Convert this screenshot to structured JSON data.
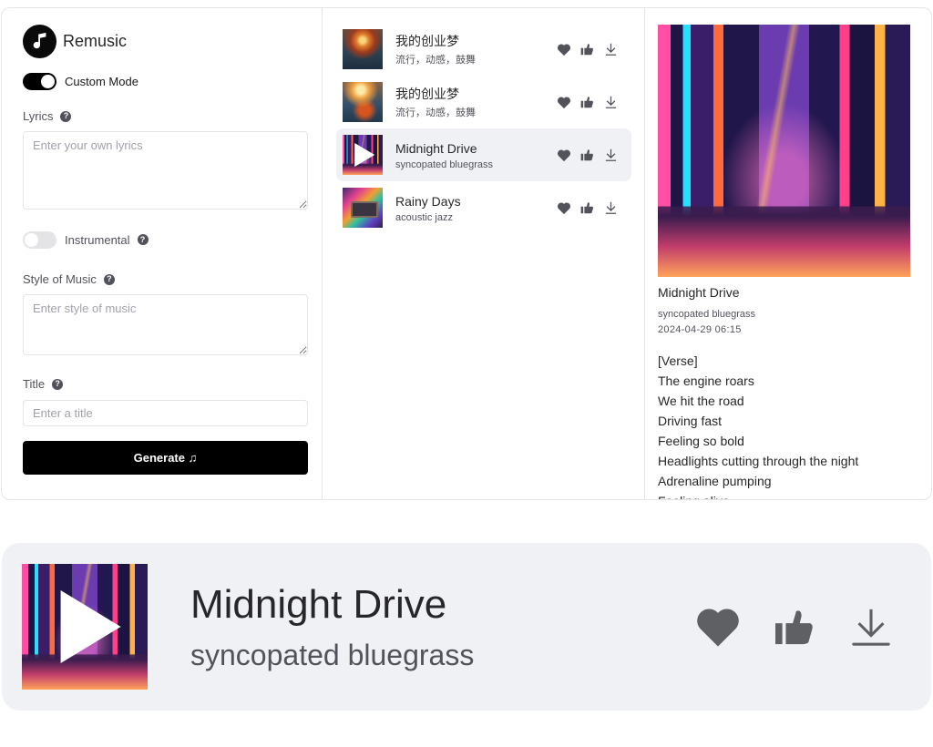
{
  "app": {
    "name": "Remusic",
    "logo_icon": "music-note-icon"
  },
  "form": {
    "custom_mode": {
      "label": "Custom Mode",
      "on": true
    },
    "lyrics": {
      "label": "Lyrics",
      "placeholder": "Enter your own lyrics",
      "value": ""
    },
    "instrumental": {
      "label": "Instrumental",
      "on": false
    },
    "style": {
      "label": "Style of Music",
      "placeholder": "Enter style of music",
      "value": ""
    },
    "title": {
      "label": "Title",
      "placeholder": "Enter a title",
      "value": ""
    },
    "generate_label": "Generate ♫",
    "help_glyph": "?"
  },
  "songs": [
    {
      "title": "我的创业梦",
      "style": "流行，动感，鼓舞",
      "art": "phoenix-1",
      "active": false
    },
    {
      "title": "我的创业梦",
      "style": "流行，动感，鼓舞",
      "art": "phoenix-2",
      "active": false
    },
    {
      "title": "Midnight Drive",
      "style": "syncopated bluegrass",
      "art": "neon-city",
      "active": true
    },
    {
      "title": "Rainy Days",
      "style": "acoustic jazz",
      "art": "cassette",
      "active": false
    }
  ],
  "song_actions": [
    "heart-icon",
    "thumbs-up-icon",
    "download-icon"
  ],
  "detail": {
    "title": "Midnight Drive",
    "style": "syncopated bluegrass",
    "date": "2024-04-29 06:15",
    "lyrics": [
      "[Verse]",
      "The engine roars",
      "We hit the road",
      "Driving fast",
      "Feeling so bold",
      "Headlights cutting through the night",
      "Adrenaline pumping",
      "Feeling alive"
    ]
  },
  "player": {
    "title": "Midnight Drive",
    "style": "syncopated bluegrass"
  },
  "colors": {
    "accent": "#000000",
    "active_row": "#f0f1f5",
    "icon": "#52525b",
    "border": "#e4e4e7"
  }
}
